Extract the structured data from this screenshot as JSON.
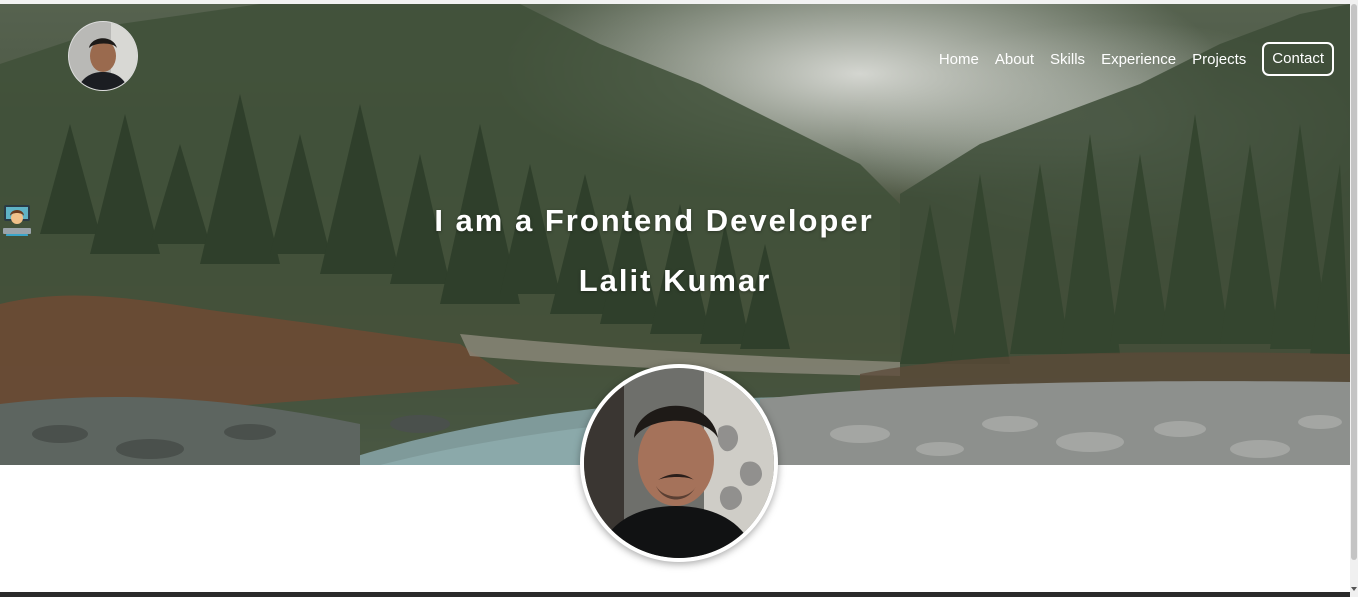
{
  "header": {
    "logo_alt": "profile photo",
    "nav": [
      {
        "label": "Home"
      },
      {
        "label": "About"
      },
      {
        "label": "Skills"
      },
      {
        "label": "Experience"
      },
      {
        "label": "Projects"
      }
    ],
    "contact_label": "Contact"
  },
  "hero": {
    "headline": "I am a Frontend Developer",
    "headline_emoji": "woman-technologist-icon",
    "name": "Lalit Kumar"
  },
  "colors": {
    "text": "#ffffff",
    "page_background": "#ffffff"
  }
}
